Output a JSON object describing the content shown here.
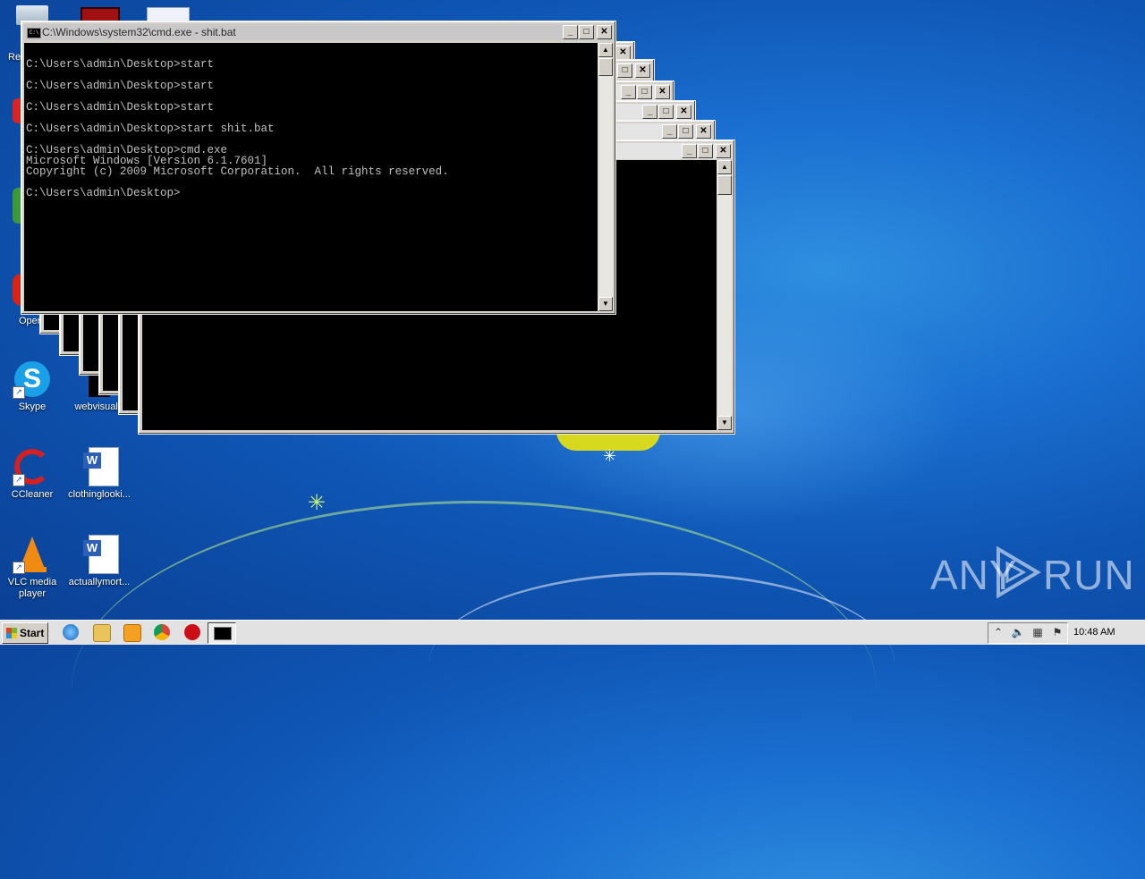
{
  "main_window": {
    "title": "C:\\Windows\\system32\\cmd.exe - shit.bat",
    "console_lines": [
      "",
      "C:\\Users\\admin\\Desktop>start",
      "",
      "C:\\Users\\admin\\Desktop>start",
      "",
      "C:\\Users\\admin\\Desktop>start",
      "",
      "C:\\Users\\admin\\Desktop>start shit.bat",
      "",
      "C:\\Users\\admin\\Desktop>cmd.exe",
      "Microsoft Windows [Version 6.1.7601]",
      "Copyright (c) 2009 Microsoft Corporation.  All rights reserved.",
      "",
      "C:\\Users\\admin\\Desktop>"
    ],
    "minimize_glyph": "_",
    "maximize_glyph": "□",
    "close_glyph": "✕"
  },
  "desktop_icons": [
    {
      "label": "Skype",
      "icon": "skype-icon"
    },
    {
      "label": "webvisual.r",
      "icon": "image-file-icon"
    },
    {
      "label": "CCleaner",
      "icon": "ccleaner-icon"
    },
    {
      "label": "clothinglooki...",
      "icon": "word-document-icon"
    },
    {
      "label": "VLC media player",
      "icon": "vlc-icon"
    },
    {
      "label": "actuallymort...",
      "icon": "word-document-icon"
    }
  ],
  "partial_labels": {
    "recycle": "Re",
    "opera": "Oper"
  },
  "taskbar": {
    "start_label": "Start",
    "clock": "10:48 AM",
    "quick_launch": [
      "internet-explorer-icon",
      "explorer-icon",
      "media-player-icon",
      "chrome-icon",
      "opera-icon"
    ],
    "tray_icons": [
      "show-hidden-icon",
      "volume-icon",
      "network-icon",
      "action-center-flag-icon"
    ]
  },
  "watermark": {
    "left": "ANY",
    "right": "RUN"
  },
  "colors": {
    "desktop_blue": "#1a6fd0",
    "console_bg": "#000000",
    "console_text": "#c0c0c0"
  }
}
